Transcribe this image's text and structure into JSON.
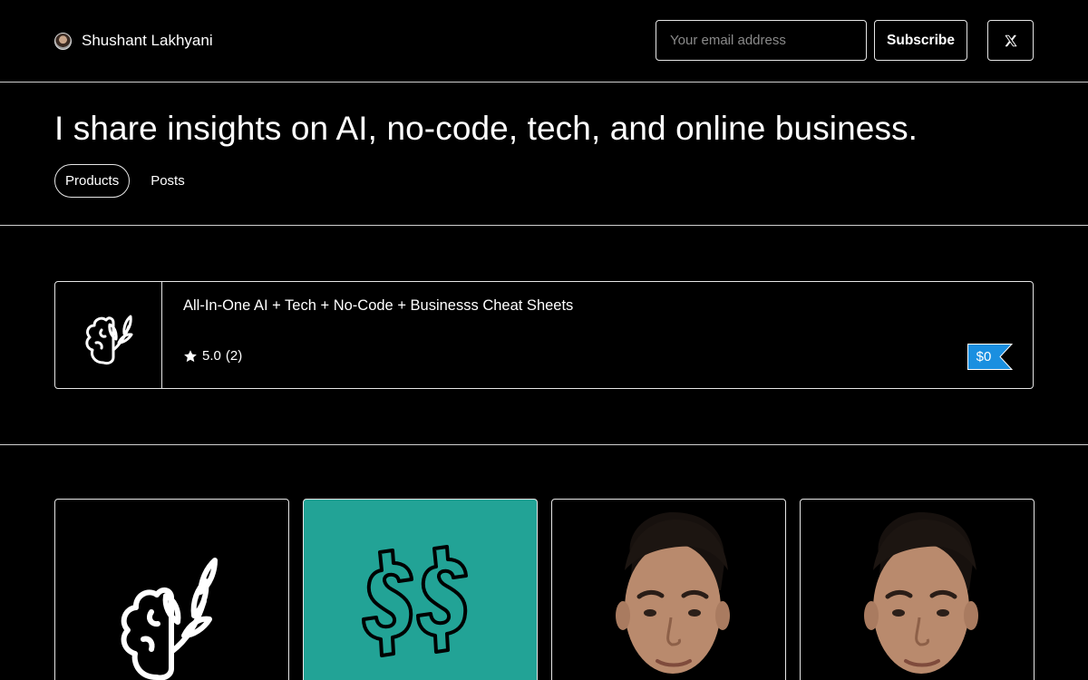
{
  "header": {
    "author_name": "Shushant Lakhyani",
    "email_placeholder": "Your email address",
    "subscribe_label": "Subscribe",
    "social_icon": "x-logo-icon"
  },
  "hero": {
    "headline": "I share insights on AI, no-code, tech, and online business.",
    "tabs": [
      {
        "label": "Products",
        "active": true
      },
      {
        "label": "Posts",
        "active": false
      }
    ]
  },
  "featured_product": {
    "title": "All-In-One AI + Tech + No-Code + Businesss Cheat Sheets",
    "rating": "5.0",
    "rating_count": "(2)",
    "price": "$0",
    "thumbnail_icon": "brain-leaf-icon"
  },
  "product_grid": [
    {
      "image": "brain-leaf-icon"
    },
    {
      "image": "dollar-sign-icon"
    },
    {
      "image": "portrait-photo"
    },
    {
      "image": "portrait-photo"
    }
  ],
  "colors": {
    "background": "#000000",
    "border": "#e6e6e6",
    "price_badge": "#1a8fe0",
    "teal_card": "#22a396"
  }
}
